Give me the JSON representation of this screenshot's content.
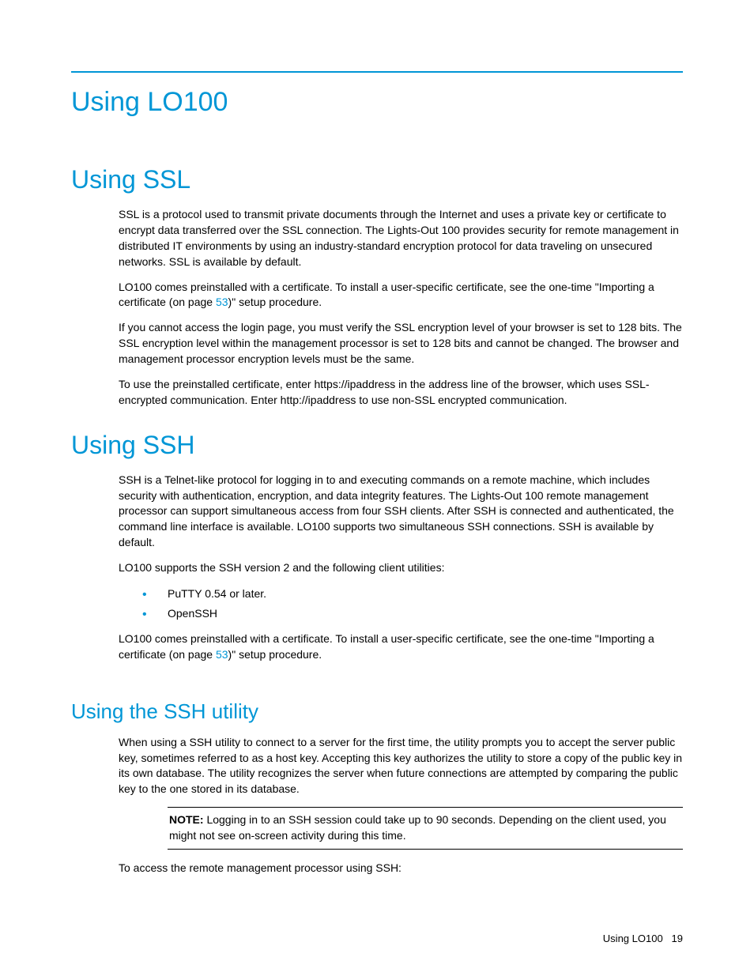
{
  "chapter": "Using LO100",
  "ssl": {
    "heading": "Using SSL",
    "p1": "SSL is a protocol used to transmit private documents through the Internet and uses a private key or certificate to encrypt data transferred over the SSL connection. The Lights-Out 100 provides security for remote management in distributed IT environments by using an industry-standard encryption protocol for data traveling on unsecured networks. SSL is available by default.",
    "p2a": "LO100 comes preinstalled with a certificate. To install a user-specific certificate, see the one-time \"Importing a certificate (on page ",
    "p2link": "53",
    "p2b": ")\" setup procedure.",
    "p3": "If you cannot access the login page, you must verify the SSL encryption level of your browser is set to 128 bits. The SSL encryption level within the management processor is set to 128 bits and cannot be changed. The browser and management processor encryption levels must be the same.",
    "p4": "To use the preinstalled certificate, enter https://ipaddress in the address line of the browser, which uses SSL-encrypted communication. Enter http://ipaddress to use non-SSL encrypted communication."
  },
  "ssh": {
    "heading": "Using SSH",
    "p1": "SSH is a Telnet-like protocol for logging in to and executing commands on a remote machine, which includes security with authentication, encryption, and data integrity features. The Lights-Out 100 remote management processor can support simultaneous access from four SSH clients. After SSH is connected and authenticated, the command line interface is available. LO100 supports two simultaneous SSH connections. SSH is available by default.",
    "p2": "LO100 supports the SSH version 2 and the following client utilities:",
    "bullets": [
      "PuTTY 0.54 or later.",
      "OpenSSH"
    ],
    "p3a": "LO100 comes preinstalled with a certificate. To install a user-specific certificate, see the one-time \"Importing a certificate (on page ",
    "p3link": "53",
    "p3b": ")\" setup procedure."
  },
  "sshutil": {
    "heading": "Using the SSH utility",
    "p1": "When using a SSH utility to connect to a server for the first time, the utility prompts you to accept the server public key, sometimes referred to as a host key. Accepting this key authorizes the utility to store a copy of the public key in its own database. The utility recognizes the server when future connections are attempted by comparing the public key to the one stored in its database.",
    "note_label": "NOTE:",
    "note_text": " Logging in to an SSH session could take up to 90 seconds. Depending on the client used, you might not see on-screen activity during this time.",
    "p2": "To access the remote management processor using SSH:"
  },
  "footer": {
    "section": "Using LO100",
    "page": "19"
  }
}
